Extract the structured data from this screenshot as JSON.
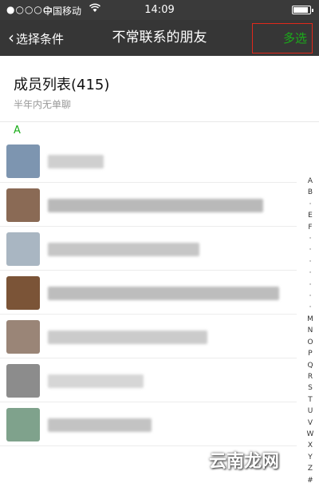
{
  "status_bar": {
    "signal": "●○○○○",
    "carrier": "中国移动",
    "wifi_icon": "wifi-icon",
    "time": "14:09",
    "battery_icon": "battery-icon"
  },
  "nav": {
    "back_label": "选择条件",
    "title": "不常联系的朋友",
    "multi_select_label": "多选",
    "accent_color": "#1aad19"
  },
  "header": {
    "title": "成员列表(415)",
    "subtitle": "半年内无单聊"
  },
  "section": {
    "letter": "A"
  },
  "members": [
    {
      "avatar_color": "#7d95b0",
      "name_color": "#cfcfcf"
    },
    {
      "avatar_color": "#8a6a55",
      "name_color": "#b9b9b9"
    },
    {
      "avatar_color": "#a9b6c2",
      "name_color": "#c6c6c6"
    },
    {
      "avatar_color": "#7b5437",
      "name_color": "#bdbdbd"
    },
    {
      "avatar_color": "#9a8577",
      "name_color": "#cbcbcb"
    },
    {
      "avatar_color": "#8c8c8c",
      "name_color": "#d6d6d6"
    },
    {
      "avatar_color": "#7fa28c",
      "name_color": "#c3c3c3"
    }
  ],
  "index_letters": [
    "A",
    "B",
    "·",
    "E",
    "F",
    "·",
    "·",
    "·",
    "·",
    "·",
    "·",
    "·",
    "M",
    "N",
    "O",
    "P",
    "Q",
    "R",
    "S",
    "T",
    "U",
    "V",
    "W",
    "X",
    "Y",
    "Z",
    "#"
  ],
  "watermark": "云南龙网"
}
